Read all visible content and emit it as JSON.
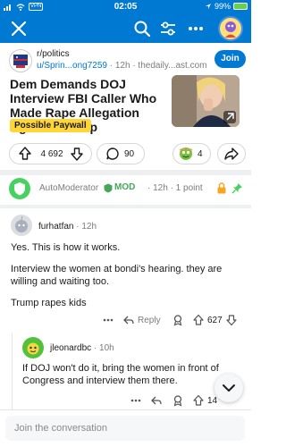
{
  "status_bar": {
    "time": "02:05",
    "vpn_label": "VPN",
    "battery_text": "99%"
  },
  "post": {
    "subreddit": "r/politics",
    "username": "u/Sprin...ong7259",
    "age": "12h",
    "domain": "thedaily...ast.com",
    "join_label": "Join",
    "title": "Dem Demands DOJ Interview FBI Caller Who Made Rape Allegation Against Trump",
    "flair": "Possible Paywall",
    "score": "4 692",
    "comments_count": "90",
    "awards_count": "4"
  },
  "automod": {
    "name": "AutoModerator",
    "badge": "MOD",
    "meta": "· 12h · 1 point"
  },
  "comment1": {
    "username": "furhatfan",
    "age": "· 12h",
    "paragraphs": [
      "Yes. This is how it works.",
      "Interview the women at bondi's hearing. they are willing and waiting too.",
      "Trump rapes kids"
    ],
    "reply_label": "Reply",
    "score": "627"
  },
  "comment2": {
    "username": "jleonardbc",
    "age": "· 10h",
    "body": "If DOJ won't do it, bring the women in front of Congress and interview them there.",
    "score": "14"
  },
  "reply_box": {
    "placeholder": "Join the conversation"
  },
  "colors": {
    "brand_blue": "#0079d3",
    "flair_yellow": "#ffd635",
    "mod_green": "#46d160"
  }
}
